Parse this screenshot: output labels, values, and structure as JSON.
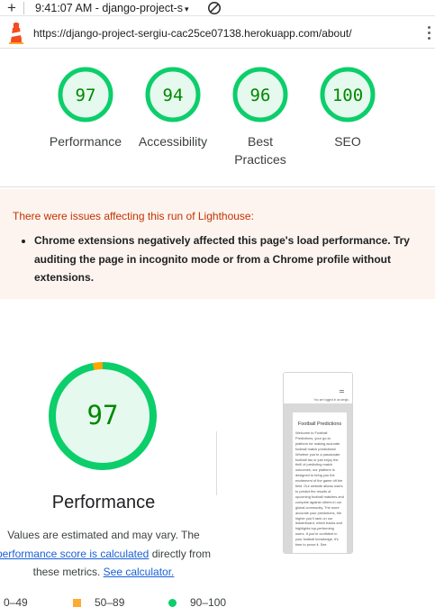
{
  "topbar": {
    "tab_title": "9:41:07 AM - django-project-s",
    "caret": "▾"
  },
  "urlbar": {
    "url": "https://django-project-sergiu-cac25ce07138.herokuapp.com/about/"
  },
  "scores": [
    {
      "value": "97",
      "label": "Performance"
    },
    {
      "value": "94",
      "label": "Accessibility"
    },
    {
      "value": "96",
      "label_line1": "Best",
      "label_line2": "Practices"
    },
    {
      "value": "100",
      "label": "SEO"
    }
  ],
  "colors": {
    "pass": "#0cce6b",
    "pass_text": "#008800",
    "pass_fill": "#e6f9ee",
    "average": "#ffa400",
    "warning_bg": "#fdf4ef",
    "warning_title": "#c33300"
  },
  "warning": {
    "title": "There were issues affecting this run of Lighthouse:",
    "items": [
      "Chrome extensions negatively affected this page's load performance. Try auditing the page in incognito mode or from a Chrome profile without extensions."
    ]
  },
  "performance": {
    "score": "97",
    "score_fraction": 0.97,
    "title": "Performance",
    "desc_part1": "Values are estimated and may vary. The ",
    "desc_link1": "performance score is calculated",
    "desc_part2": " directly from these metrics. ",
    "desc_link2": "See calculator."
  },
  "thumbnail": {
    "nav_text": "You are logged in as sergiu",
    "heading": "Football Predictions",
    "body": "Welcome to Football Predictions, your go-to platform for making accurate football match predictions! Whether you're a passionate football fan or just enjoy the thrill of predicting match outcomes, our platform is designed to bring you the excitement of the game off the field. Our website allows users to predict the results of upcoming football matches and compete against others in our global community. The more accurate your predictions, the higher you'll rank on our leaderboard, which tracks and highlights top-performing users. If you're confident in your football knowledge, it's time to prove it. See"
  },
  "legend": {
    "fail": "0–49",
    "average": "50–89",
    "pass": "90–100"
  }
}
